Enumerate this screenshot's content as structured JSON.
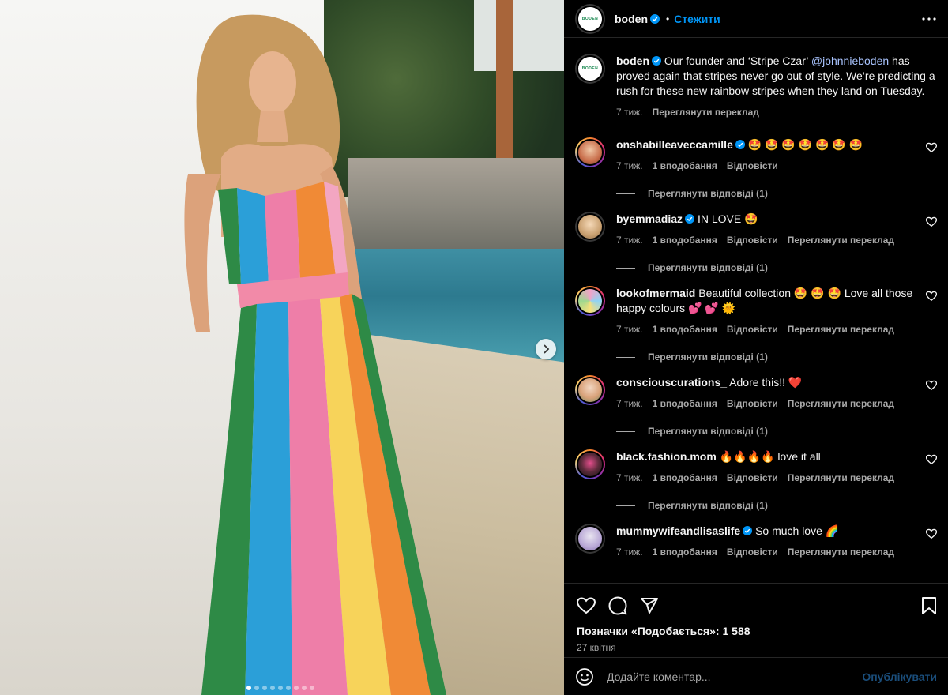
{
  "post": {
    "username": "boden",
    "follow_label": "Стежити",
    "logo_text": "BODEN",
    "carousel_dots": 9,
    "carousel_active": 0
  },
  "caption": {
    "username": "boden",
    "text_before": " Our founder and ‘Stripe Czar’ ",
    "mention": "@johnnieboden",
    "text_after": " has proved again that stripes never go out of style. We’re predicting a rush for these new rainbow stripes when they land on Tuesday.",
    "time": "7 тиж.",
    "translate": "Переглянути переклад"
  },
  "comments": [
    {
      "username": "onshabilleaveccamille",
      "verified": true,
      "text": "🤩 🤩 🤩 🤩 🤩 🤩 🤩",
      "time": "7 тиж.",
      "likes": "1 вподобання",
      "reply": "Відповісти",
      "translate": "",
      "replies": "Переглянути відповіді (1)"
    },
    {
      "username": "byemmadiaz",
      "verified": true,
      "text": "IN LOVE 🤩",
      "time": "7 тиж.",
      "likes": "1 вподобання",
      "reply": "Відповісти",
      "translate": "Переглянути переклад",
      "replies": "Переглянути відповіді (1)"
    },
    {
      "username": "lookofmermaid",
      "verified": false,
      "text": "Beautiful collection 🤩 🤩 🤩 Love all those happy colours 💕 💕 🌞",
      "time": "7 тиж.",
      "likes": "1 вподобання",
      "reply": "Відповісти",
      "translate": "Переглянути переклад",
      "replies": "Переглянути відповіді (1)"
    },
    {
      "username": "consciouscurations_",
      "verified": false,
      "text": "Adore this!! ❤️",
      "time": "7 тиж.",
      "likes": "1 вподобання",
      "reply": "Відповісти",
      "translate": "Переглянути переклад",
      "replies": "Переглянути відповіді (1)"
    },
    {
      "username": "black.fashion.mom",
      "verified": false,
      "text": "🔥🔥🔥🔥 love it all",
      "time": "7 тиж.",
      "likes": "1 вподобання",
      "reply": "Відповісти",
      "translate": "Переглянути переклад",
      "replies": "Переглянути відповіді (1)"
    },
    {
      "username": "mummywifeandlisaslife",
      "verified": true,
      "text": "So much love 🌈",
      "time": "7 тиж.",
      "likes": "1 вподобання",
      "reply": "Відповісти",
      "translate": "Переглянути переклад",
      "replies": ""
    }
  ],
  "actions": {
    "likes_text": "Позначки «Подобається»: 1 588",
    "date": "27 квітня",
    "comment_placeholder": "Додайте коментар...",
    "publish_label": "Опублікувати"
  },
  "colors": {
    "accent": "#0095f6",
    "verified": "#0095f6",
    "muted": "#a8a8a8",
    "background": "#000000"
  },
  "icons": [
    "more-icon",
    "verified-icon",
    "heart-icon",
    "comment-icon",
    "share-icon",
    "bookmark-icon",
    "emoji-icon",
    "chevron-right-icon"
  ]
}
